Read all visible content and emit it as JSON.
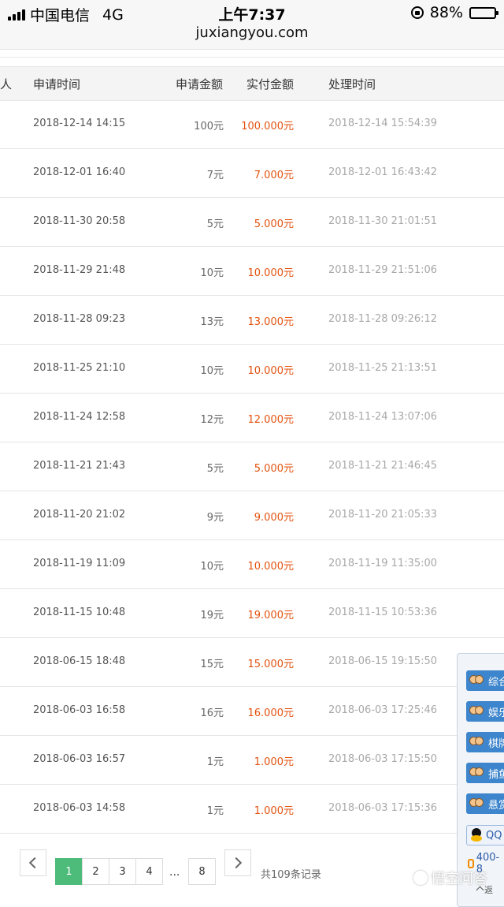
{
  "status_bar": {
    "carrier": "中国电信",
    "network": "4G",
    "time": "上午7:37",
    "url": "juxiangyou.com",
    "battery": "88%",
    "battery_level": 0.88
  },
  "table": {
    "headers": {
      "applicant_partial": "人",
      "apply_time": "申请时间",
      "apply_amount": "申请金额",
      "paid_amount": "实付金额",
      "process_time": "处理时间"
    },
    "rows": [
      {
        "apply_time": "2018-12-14 14:15",
        "apply_amount": "100元",
        "paid_amount": "100.000元",
        "process_time": "2018-12-14 15:54:39"
      },
      {
        "apply_time": "2018-12-01 16:40",
        "apply_amount": "7元",
        "paid_amount": "7.000元",
        "process_time": "2018-12-01 16:43:42"
      },
      {
        "apply_time": "2018-11-30 20:58",
        "apply_amount": "5元",
        "paid_amount": "5.000元",
        "process_time": "2018-11-30 21:01:51"
      },
      {
        "apply_time": "2018-11-29 21:48",
        "apply_amount": "10元",
        "paid_amount": "10.000元",
        "process_time": "2018-11-29 21:51:06"
      },
      {
        "apply_time": "2018-11-28 09:23",
        "apply_amount": "13元",
        "paid_amount": "13.000元",
        "process_time": "2018-11-28 09:26:12"
      },
      {
        "apply_time": "2018-11-25 21:10",
        "apply_amount": "10元",
        "paid_amount": "10.000元",
        "process_time": "2018-11-25 21:13:51"
      },
      {
        "apply_time": "2018-11-24 12:58",
        "apply_amount": "12元",
        "paid_amount": "12.000元",
        "process_time": "2018-11-24 13:07:06"
      },
      {
        "apply_time": "2018-11-21 21:43",
        "apply_amount": "5元",
        "paid_amount": "5.000元",
        "process_time": "2018-11-21 21:46:45"
      },
      {
        "apply_time": "2018-11-20 21:02",
        "apply_amount": "9元",
        "paid_amount": "9.000元",
        "process_time": "2018-11-20 21:05:33"
      },
      {
        "apply_time": "2018-11-19 11:09",
        "apply_amount": "10元",
        "paid_amount": "10.000元",
        "process_time": "2018-11-19 11:35:00"
      },
      {
        "apply_time": "2018-11-15 10:48",
        "apply_amount": "19元",
        "paid_amount": "19.000元",
        "process_time": "2018-11-15 10:53:36"
      },
      {
        "apply_time": "2018-06-15 18:48",
        "apply_amount": "15元",
        "paid_amount": "15.000元",
        "process_time": "2018-06-15 19:15:50"
      },
      {
        "apply_time": "2018-06-03 16:58",
        "apply_amount": "16元",
        "paid_amount": "16.000元",
        "process_time": "2018-06-03 17:25:46"
      },
      {
        "apply_time": "2018-06-03 16:57",
        "apply_amount": "1元",
        "paid_amount": "1.000元",
        "process_time": "2018-06-03 17:15:50"
      },
      {
        "apply_time": "2018-06-03 14:58",
        "apply_amount": "1元",
        "paid_amount": "1.000元",
        "process_time": "2018-06-03 17:15:36"
      }
    ]
  },
  "pagination": {
    "prev_icon": "chevron-left-icon",
    "next_icon": "chevron-right-icon",
    "pages": [
      "1",
      "2",
      "3",
      "4"
    ],
    "ellipsis": "...",
    "last_page": "8",
    "current_page": "1",
    "total": "共109条记录"
  },
  "side_panel": {
    "items": [
      "综合",
      "娱乐",
      "棋牌",
      "捕鱼",
      "悬赏"
    ],
    "qq_label": "QQ",
    "phone": "400-8"
  },
  "watermark": {
    "text": "悟空问答",
    "back_label": "返"
  },
  "colors": {
    "paid_amount": "#e3520f",
    "page_active": "#4dbb79",
    "side_button": "#3d85cc"
  }
}
